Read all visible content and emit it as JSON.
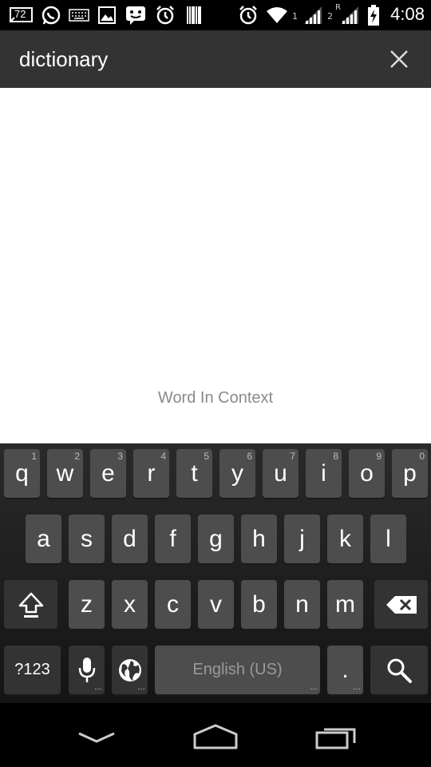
{
  "status_bar": {
    "time": "4:08",
    "notification_badge": "72",
    "sim1_label": "1",
    "sim2_label": "2",
    "roaming_label": "R",
    "icons": [
      "notification-count-icon",
      "whatsapp-icon",
      "keyboard-icon",
      "gallery-icon",
      "messenger-icon",
      "alarm-icon",
      "barcode-icon",
      "alarm-icon",
      "wifi-icon",
      "signal-icon",
      "signal-roaming-icon",
      "battery-charging-icon"
    ]
  },
  "search": {
    "value": "dictionary",
    "clear_icon": "close-icon"
  },
  "content": {
    "label": "Word In Context"
  },
  "keyboard": {
    "row1": [
      {
        "key": "q",
        "hint": "1"
      },
      {
        "key": "w",
        "hint": "2"
      },
      {
        "key": "e",
        "hint": "3"
      },
      {
        "key": "r",
        "hint": "4"
      },
      {
        "key": "t",
        "hint": "5"
      },
      {
        "key": "y",
        "hint": "6"
      },
      {
        "key": "u",
        "hint": "7"
      },
      {
        "key": "i",
        "hint": "8"
      },
      {
        "key": "o",
        "hint": "9"
      },
      {
        "key": "p",
        "hint": "0"
      }
    ],
    "row2": [
      "a",
      "s",
      "d",
      "f",
      "g",
      "h",
      "j",
      "k",
      "l"
    ],
    "row3": [
      "z",
      "x",
      "c",
      "v",
      "b",
      "n",
      "m"
    ],
    "symbols_label": "?123",
    "space_label": "English (US)",
    "period_label": "."
  },
  "colors": {
    "search_bar_bg": "#333333",
    "key_bg": "#4d4d4d",
    "context_text": "#8a8a8a"
  }
}
